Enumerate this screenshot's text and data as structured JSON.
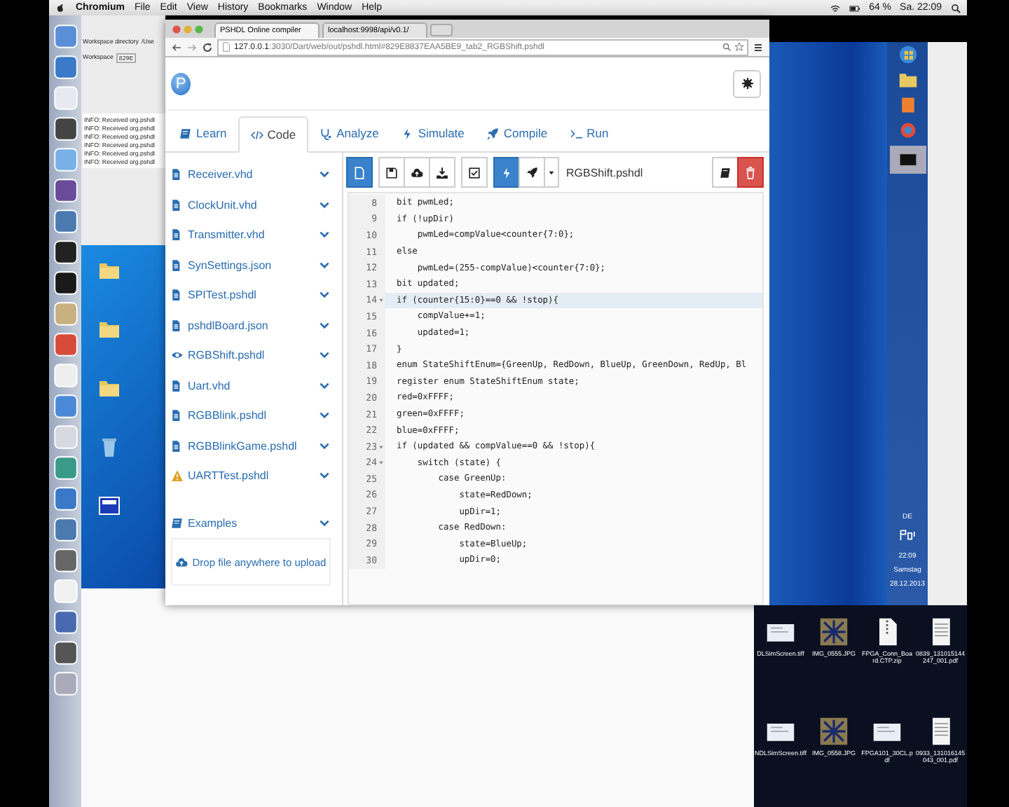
{
  "menubar": {
    "app": "Chromium",
    "menus": [
      "File",
      "Edit",
      "View",
      "History",
      "Bookmarks",
      "Window",
      "Help"
    ],
    "battery": "64 %",
    "clock": "Sa. 22:09"
  },
  "background_window": {
    "label_1": "Workspace directory",
    "value_1": "/Use",
    "label_2": "Workspace",
    "value_2": "829E",
    "console": [
      "INFO: Received org.pshdl",
      "INFO: Received org.pshdl",
      "INFO: Received org.pshdl",
      "INFO: Received org.pshdl",
      "INFO: Received org.pshdl",
      "INFO: Received org.pshdl"
    ]
  },
  "browser": {
    "tabs": [
      {
        "title": "PSHDL Online compiler",
        "selected": true
      },
      {
        "title": "localhost:9998/api/v0.1/",
        "selected": false
      }
    ],
    "url_host": "127.0.0.1",
    "url_rest": ":3030/Dart/web/out/pshdl.html#829E8837EAA5BE9_tab2_RGBShift.pshdl"
  },
  "app": {
    "logo": "P",
    "nav": [
      {
        "kind": "learn",
        "label": "Learn",
        "selected": false
      },
      {
        "kind": "code",
        "label": "Code",
        "selected": true
      },
      {
        "kind": "analyze",
        "label": "Analyze",
        "selected": false
      },
      {
        "kind": "simulate",
        "label": "Simulate",
        "selected": false
      },
      {
        "kind": "compile",
        "label": "Compile",
        "selected": false
      },
      {
        "kind": "run",
        "label": "Run",
        "selected": false
      }
    ],
    "files": [
      {
        "kind": "file",
        "name": "Receiver.vhd"
      },
      {
        "kind": "file",
        "name": "ClockUnit.vhd"
      },
      {
        "kind": "file",
        "name": "Transmitter.vhd"
      },
      {
        "kind": "file",
        "name": "SynSettings.json"
      },
      {
        "kind": "file",
        "name": "SPITest.pshdl"
      },
      {
        "kind": "file",
        "name": "pshdlBoard.json"
      },
      {
        "kind": "viewing",
        "name": "RGBShift.pshdl"
      },
      {
        "kind": "file",
        "name": "Uart.vhd"
      },
      {
        "kind": "file",
        "name": "RGBBlink.pshdl"
      },
      {
        "kind": "file",
        "name": "RGBBlinkGame.pshdl"
      },
      {
        "kind": "warning",
        "name": "UARTTest.pshdl"
      }
    ],
    "examples": "Examples",
    "upload": "Drop file anywhere to upload",
    "toolbar": [
      {
        "kind": "new",
        "selected": true
      },
      {
        "kind": "save",
        "selected": false
      },
      {
        "kind": "upload",
        "selected": false
      },
      {
        "kind": "download",
        "selected": false
      },
      {
        "kind": "check",
        "selected": false
      },
      {
        "kind": "bolt",
        "selected": true
      },
      {
        "kind": "rocket",
        "selected": false
      },
      {
        "kind": "caret",
        "selected": false
      }
    ],
    "filename": "RGBShift.pshdl",
    "code": [
      {
        "n": "8",
        "text": "bit pwmLed;",
        "fold": false,
        "active": false
      },
      {
        "n": "9",
        "text": "if (!upDir)",
        "fold": false,
        "active": false
      },
      {
        "n": "10",
        "text": "    pwmLed=compValue<counter{7:0};",
        "fold": false,
        "active": false
      },
      {
        "n": "11",
        "text": "else",
        "fold": false,
        "active": false
      },
      {
        "n": "12",
        "text": "    pwmLed=(255-compValue)<counter{7:0};",
        "fold": false,
        "active": false
      },
      {
        "n": "13",
        "text": "bit updated;",
        "fold": false,
        "active": false
      },
      {
        "n": "14",
        "text": "if (counter{15:0}==0 && !stop){",
        "fold": true,
        "active": true
      },
      {
        "n": "15",
        "text": "    compValue+=1;",
        "fold": false,
        "active": false
      },
      {
        "n": "16",
        "text": "    updated=1;",
        "fold": false,
        "active": false
      },
      {
        "n": "17",
        "text": "}",
        "fold": false,
        "active": false
      },
      {
        "n": "18",
        "text": "enum StateShiftEnum={GreenUp, RedDown, BlueUp, GreenDown, RedUp, Bl",
        "fold": false,
        "active": false
      },
      {
        "n": "19",
        "text": "register enum StateShiftEnum state;",
        "fold": false,
        "active": false
      },
      {
        "n": "20",
        "text": "red=0xFFFF;",
        "fold": false,
        "active": false
      },
      {
        "n": "21",
        "text": "green=0xFFFF;",
        "fold": false,
        "active": false
      },
      {
        "n": "22",
        "text": "blue=0xFFFF;",
        "fold": false,
        "active": false
      },
      {
        "n": "23",
        "text": "if (updated && compValue==0 && !stop){",
        "fold": true,
        "active": false
      },
      {
        "n": "24",
        "text": "    switch (state) {",
        "fold": true,
        "active": false
      },
      {
        "n": "25",
        "text": "        case GreenUp:",
        "fold": false,
        "active": false
      },
      {
        "n": "26",
        "text": "            state=RedDown;",
        "fold": false,
        "active": false
      },
      {
        "n": "27",
        "text": "            upDir=1;",
        "fold": false,
        "active": false
      },
      {
        "n": "28",
        "text": "        case RedDown:",
        "fold": false,
        "active": false
      },
      {
        "n": "29",
        "text": "            state=BlueUp;",
        "fold": false,
        "active": false
      },
      {
        "n": "30",
        "text": "            upDir=0;",
        "fold": false,
        "active": false
      }
    ]
  },
  "vm": {
    "language": "DE",
    "time": "22:09",
    "day": "Samstag",
    "date": "28.12.2013"
  },
  "desktop_files": [
    {
      "kind": "document",
      "name": "DLSimScreen.tiff"
    },
    {
      "kind": "photo",
      "name": "IMG_0555.JPG"
    },
    {
      "kind": "zip",
      "name": "FPGA_Conn_Board.CTP.zip"
    },
    {
      "kind": "pdf",
      "name": "0839_131015144247_001.pdf"
    },
    {
      "kind": "document",
      "name": "NDLSimScreen.tiff"
    },
    {
      "kind": "photo",
      "name": "IMG_0558.JPG"
    },
    {
      "kind": "document",
      "name": "FPGA101_30CL.pdf"
    },
    {
      "kind": "pdf",
      "name": "0933_131016145043_001.pdf"
    }
  ]
}
